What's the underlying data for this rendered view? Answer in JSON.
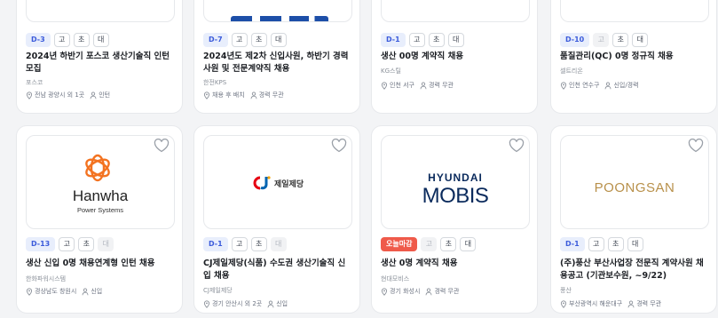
{
  "top_row": [
    {
      "dday": "D-3",
      "tags": [
        "고",
        "초",
        "대"
      ],
      "title": "2024년 하반기 포스코 생산기술직 인턴모집",
      "company": "포스코",
      "location": "전남 광양시 외 1곳",
      "career": "인턴"
    },
    {
      "dday": "D-7",
      "tags": [
        "고",
        "초",
        "대"
      ],
      "title": "2024년도 제2차 신입사원, 하반기 경력사원 및 전문계약직 채용",
      "company": "한전KPS",
      "location": "채용 후 배치",
      "career": "경력 무관"
    },
    {
      "dday": "D-1",
      "tags": [
        "고",
        "초",
        "대"
      ],
      "title": "생산 00명 계약직 채용",
      "company": "KG스틸",
      "location": "인천 서구",
      "career": "경력 무관"
    },
    {
      "dday": "D-10",
      "tags": [
        "고",
        "초",
        "대"
      ],
      "title": "품질관리(QC) 0명 정규직 채용",
      "company": "셀트리온",
      "location": "인천 연수구",
      "career": "신입/경력"
    }
  ],
  "bottom_row": [
    {
      "logo": "Hanwha Power Systems",
      "logo_line1": "Hanwha",
      "logo_line2": "Power Systems",
      "dday": "D-13",
      "tags": [
        "고",
        "초",
        "대"
      ],
      "title": "생산 신입 0명 채용연계형 인턴 채용",
      "company": "한화파워시스템",
      "location": "경상남도 창원시",
      "career": "신입"
    },
    {
      "logo": "CJ 제일제당",
      "logo_line1": "CJ",
      "logo_line2": "제일제당",
      "dday": "D-1",
      "tags": [
        "고",
        "초",
        "대"
      ],
      "title": "CJ제일제당(식품) 수도권 생산기술직 신입 채용",
      "company": "CJ제일제당",
      "location": "경기 안산시 외 2곳",
      "career": "신입"
    },
    {
      "logo": "HYUNDAI MOBIS",
      "logo_line1": "HYUNDAI",
      "logo_line2": "MOBIS",
      "dday": "오늘마감",
      "tags": [
        "고",
        "초",
        "대"
      ],
      "title": "생산 0명 계약직 채용",
      "company": "현대모비스",
      "location": "경기 화성시",
      "career": "경력 무관"
    },
    {
      "logo": "POONGSAN",
      "logo_line1": "POONGSAN",
      "dday": "D-1",
      "tags": [
        "고",
        "초",
        "대"
      ],
      "title": "(주)풍산 부산사업장 전문직 계약사원 채용공고 (기관보수원, ~9/22)",
      "company": "풍산",
      "location": "부산광역시 해운대구",
      "career": "경력 무관"
    }
  ],
  "colors": {
    "accent": "#3b5bdb",
    "dday_bg": "#e8eefc",
    "today_bg": "#ef5a4a",
    "hanwha": "#f37321",
    "cj_red": "#e60012",
    "cj_blue": "#0064b1",
    "mobis_navy": "#0a2a5c",
    "poongsan_gold": "#b8904a"
  }
}
